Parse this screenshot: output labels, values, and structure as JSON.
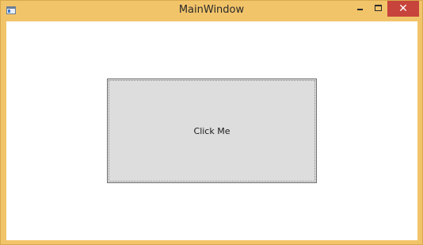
{
  "window": {
    "title": "MainWindow",
    "frame_color": "#f2c46a",
    "icon": "app-window-icon",
    "controls": {
      "minimize_icon": "minimize-icon",
      "maximize_icon": "maximize-icon",
      "close_glyph": "✕",
      "close_color": "#c7443c"
    }
  },
  "content": {
    "button_label": "Click Me",
    "button_color": "#dddddd"
  }
}
